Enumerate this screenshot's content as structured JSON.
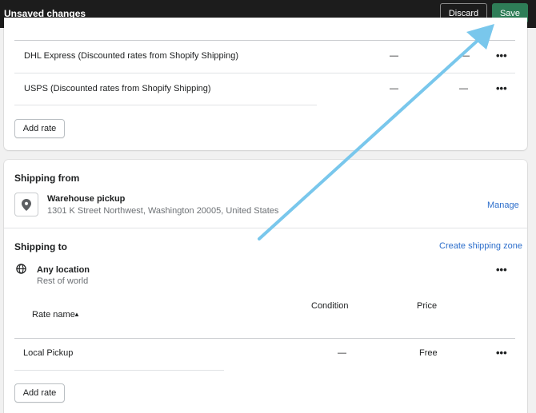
{
  "topbar": {
    "title": "Unsaved changes",
    "discard_label": "Discard",
    "save_label": "Save"
  },
  "rates_card": {
    "rows": [
      {
        "name": "DHL Express (Discounted rates from Shopify Shipping)",
        "condition": "—",
        "price": "—",
        "more": "•••"
      },
      {
        "name": "USPS (Discounted rates from Shopify Shipping)",
        "condition": "—",
        "price": "—",
        "more": "•••"
      }
    ],
    "add_rate_label": "Add rate"
  },
  "shipping_from": {
    "heading": "Shipping from",
    "location_icon": "map-pin-icon",
    "location_name": "Warehouse pickup",
    "address": "1301 K Street Northwest, Washington 20005, United States",
    "manage_label": "Manage"
  },
  "shipping_to": {
    "heading": "Shipping to",
    "create_zone_label": "Create shipping zone",
    "zone_icon": "globe-icon",
    "zone_name": "Any location",
    "zone_sub": "Rest of world",
    "zone_more": "•••",
    "columns": {
      "rate_name": "Rate name",
      "condition": "Condition",
      "price": "Price"
    },
    "sort_indicator": "▲",
    "rows": [
      {
        "name": "Local Pickup",
        "condition": "—",
        "price": "Free",
        "more": "•••"
      }
    ],
    "add_rate_label": "Add rate"
  },
  "colors": {
    "topbar_bg": "#1c1c1c",
    "save_bg": "#2e7d57",
    "link": "#2c6ecb",
    "annotation_arrow": "#79c7ec"
  }
}
